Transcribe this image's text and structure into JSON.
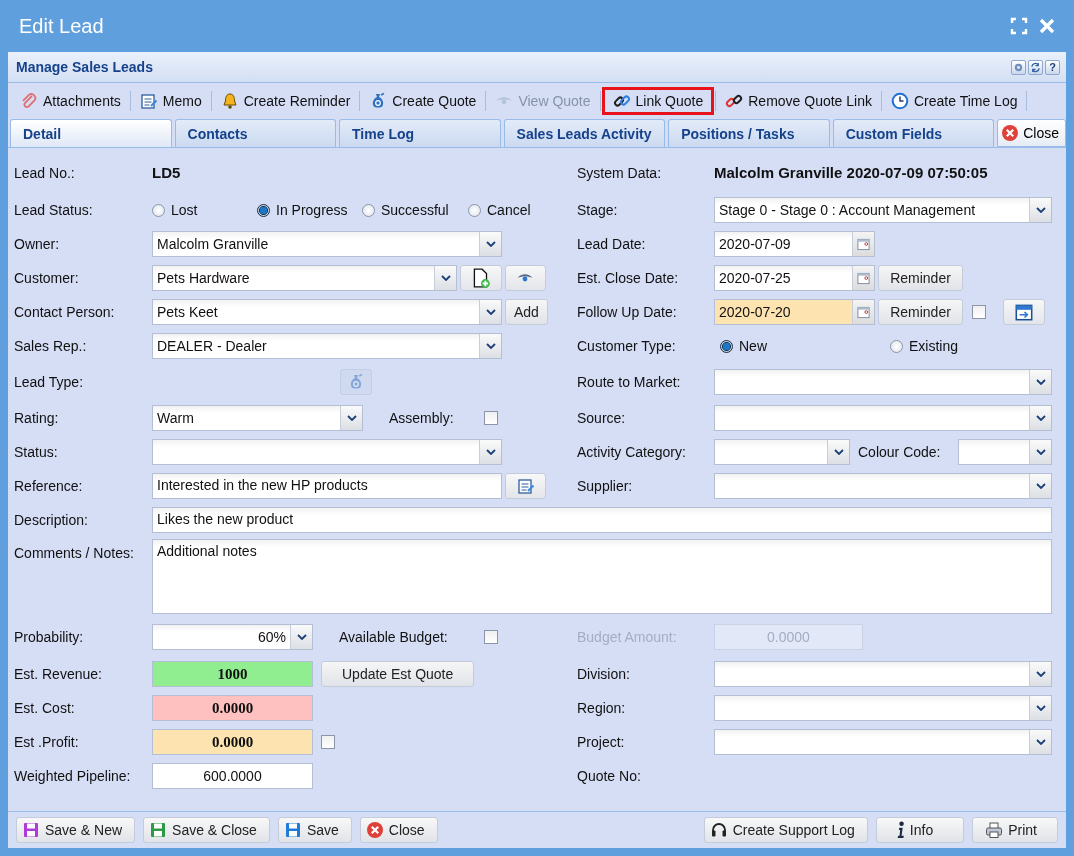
{
  "window": {
    "title": "Edit Lead"
  },
  "panel": {
    "title": "Manage Sales Leads",
    "help": "?"
  },
  "toolbar": [
    {
      "label": "Attachments",
      "disabled": false,
      "highlighted": false
    },
    {
      "label": "Memo",
      "disabled": false,
      "highlighted": false
    },
    {
      "label": "Create Reminder",
      "disabled": false,
      "highlighted": false
    },
    {
      "label": "Create Quote",
      "disabled": false,
      "highlighted": false
    },
    {
      "label": "View Quote",
      "disabled": true,
      "highlighted": false
    },
    {
      "label": "Link Quote",
      "disabled": false,
      "highlighted": true
    },
    {
      "label": "Remove Quote Link",
      "disabled": false,
      "highlighted": false
    },
    {
      "label": "Create Time Log",
      "disabled": false,
      "highlighted": false
    }
  ],
  "tabs": [
    {
      "label": "Detail",
      "selected": true
    },
    {
      "label": "Contacts",
      "selected": false
    },
    {
      "label": "Time Log",
      "selected": false
    },
    {
      "label": "Sales Leads Activity",
      "selected": false
    },
    {
      "label": "Positions / Tasks",
      "selected": false
    },
    {
      "label": "Custom Fields",
      "selected": false
    }
  ],
  "tab_close": {
    "label": "Close"
  },
  "rows": [
    {
      "kind": "pair",
      "left": {
        "label": "Lead No.:",
        "controls": [
          {
            "kind": "value",
            "text": "LD5"
          }
        ]
      },
      "right": {
        "label": "System Data:",
        "controls": [
          {
            "kind": "value",
            "text": "Malcolm Granville 2020-07-09 07:50:05"
          }
        ]
      }
    },
    {
      "kind": "pair",
      "left": {
        "label": "Lead Status:",
        "controls": [
          {
            "kind": "radio",
            "label": "Lost",
            "selected": false
          },
          {
            "kind": "radio",
            "label": "In Progress",
            "selected": true
          },
          {
            "kind": "radio",
            "label": "Successful",
            "selected": false
          },
          {
            "kind": "radio",
            "label": "Cancel",
            "selected": false
          }
        ]
      },
      "right": {
        "label": "Stage:",
        "controls": [
          {
            "kind": "combo",
            "value": "Stage 0 - Stage 0 : Account Management"
          }
        ]
      }
    },
    {
      "kind": "pair",
      "left": {
        "label": "Owner:",
        "controls": [
          {
            "kind": "combo",
            "value": "Malcolm Granville"
          }
        ]
      },
      "right": {
        "label": "Lead Date:",
        "controls": [
          {
            "kind": "date",
            "value": "2020-07-09",
            "highlighted": false
          }
        ]
      }
    },
    {
      "kind": "pair",
      "left": {
        "label": "Customer:",
        "controls": [
          {
            "kind": "combo",
            "value": "Pets Hardware"
          },
          {
            "kind": "icon-button",
            "disabled": false
          },
          {
            "kind": "icon-button",
            "disabled": false
          }
        ]
      },
      "right": {
        "label": "Est. Close Date:",
        "controls": [
          {
            "kind": "date",
            "value": "2020-07-25",
            "highlighted": false
          },
          {
            "kind": "button",
            "label": "Reminder"
          }
        ]
      }
    },
    {
      "kind": "pair",
      "left": {
        "label": "Contact Person:",
        "controls": [
          {
            "kind": "combo",
            "value": "Pets Keet"
          },
          {
            "kind": "button",
            "label": "Add"
          }
        ]
      },
      "right": {
        "label": "Follow Up Date:",
        "controls": [
          {
            "kind": "date",
            "value": "2020-07-20",
            "highlighted": true
          },
          {
            "kind": "button",
            "label": "Reminder"
          },
          {
            "kind": "checkbox",
            "checked": false
          },
          {
            "kind": "icon-button",
            "disabled": false
          }
        ]
      }
    },
    {
      "kind": "pair",
      "left": {
        "label": "Sales Rep.:",
        "controls": [
          {
            "kind": "combo",
            "value": "DEALER - Dealer"
          }
        ]
      },
      "right": {
        "label": "Customer Type:",
        "controls": [
          {
            "kind": "radio",
            "label": "New",
            "selected": true
          },
          {
            "kind": "radio",
            "label": "Existing",
            "selected": false
          }
        ]
      }
    },
    {
      "kind": "pair",
      "left": {
        "label": "Lead Type:",
        "controls": [
          {
            "kind": "icon-button",
            "disabled": true
          }
        ]
      },
      "right": {
        "label": "Route to Market:",
        "controls": [
          {
            "kind": "combo"
          }
        ]
      }
    },
    {
      "kind": "pair",
      "left": {
        "label": "Rating:",
        "controls": [
          {
            "kind": "combo",
            "value": "Warm"
          },
          {
            "kind": "label",
            "text": "Assembly:"
          },
          {
            "kind": "checkbox",
            "checked": false
          }
        ]
      },
      "right": {
        "label": "Source:",
        "controls": [
          {
            "kind": "combo"
          }
        ]
      }
    },
    {
      "kind": "pair",
      "left": {
        "label": "Status:",
        "controls": [
          {
            "kind": "combo"
          }
        ]
      },
      "right": {
        "label": "Activity Category:",
        "controls": [
          {
            "kind": "combo"
          },
          {
            "kind": "label",
            "text": "Colour Code:"
          },
          {
            "kind": "combo"
          }
        ]
      }
    },
    {
      "kind": "pair",
      "left": {
        "label": "Reference:",
        "controls": [
          {
            "kind": "input",
            "value": "Interested in the new HP products"
          },
          {
            "kind": "icon-button",
            "disabled": false
          }
        ]
      },
      "right": {
        "label": "Supplier:",
        "controls": [
          {
            "kind": "combo"
          }
        ]
      }
    },
    {
      "kind": "full",
      "label": "Description:",
      "control": {
        "kind": "input",
        "value": "Likes the new product"
      }
    },
    {
      "kind": "full",
      "label": "Comments / Notes:",
      "control": {
        "kind": "textarea",
        "value": "Additional notes"
      }
    },
    {
      "kind": "pair",
      "left": {
        "label": "Probability:",
        "controls": [
          {
            "kind": "combo",
            "value": "60%"
          },
          {
            "kind": "label",
            "text": "Available Budget:"
          },
          {
            "kind": "checkbox",
            "checked": false
          }
        ]
      },
      "right": {
        "label": "Budget Amount:",
        "disabled": true,
        "controls": [
          {
            "kind": "amount",
            "value": "0.0000",
            "bold": false,
            "color": "#e2e8f8"
          }
        ]
      }
    },
    {
      "kind": "pair",
      "left": {
        "label": "Est. Revenue:",
        "controls": [
          {
            "kind": "amount",
            "value": "1000",
            "bold": true,
            "color": "#90ee90"
          },
          {
            "kind": "button",
            "label": "Update Est Quote"
          }
        ]
      },
      "right": {
        "label": "Division:",
        "controls": [
          {
            "kind": "combo"
          }
        ]
      }
    },
    {
      "kind": "pair",
      "left": {
        "label": "Est. Cost:",
        "controls": [
          {
            "kind": "amount",
            "value": "0.0000",
            "bold": true,
            "color": "#ffc0c0"
          }
        ]
      },
      "right": {
        "label": "Region:",
        "controls": [
          {
            "kind": "combo"
          }
        ]
      }
    },
    {
      "kind": "pair",
      "left": {
        "label": "Est .Profit:",
        "controls": [
          {
            "kind": "amount",
            "value": "0.0000",
            "bold": true,
            "color": "#fde3b0"
          },
          {
            "kind": "checkbox",
            "checked": false
          }
        ]
      },
      "right": {
        "label": "Project:",
        "controls": [
          {
            "kind": "combo"
          }
        ]
      }
    },
    {
      "kind": "pair",
      "left": {
        "label": "Weighted Pipeline:",
        "controls": [
          {
            "kind": "amount",
            "value": "600.0000",
            "bold": false,
            "color": "#ffffff"
          }
        ]
      },
      "right": {
        "label": "Quote No:"
      }
    }
  ],
  "footer_left": [
    {
      "label": "Save & New"
    },
    {
      "label": "Save & Close"
    },
    {
      "label": "Save"
    },
    {
      "label": "Close"
    }
  ],
  "footer_right": [
    {
      "label": "Create Support Log"
    },
    {
      "label": "Info"
    },
    {
      "label": "Print"
    }
  ]
}
